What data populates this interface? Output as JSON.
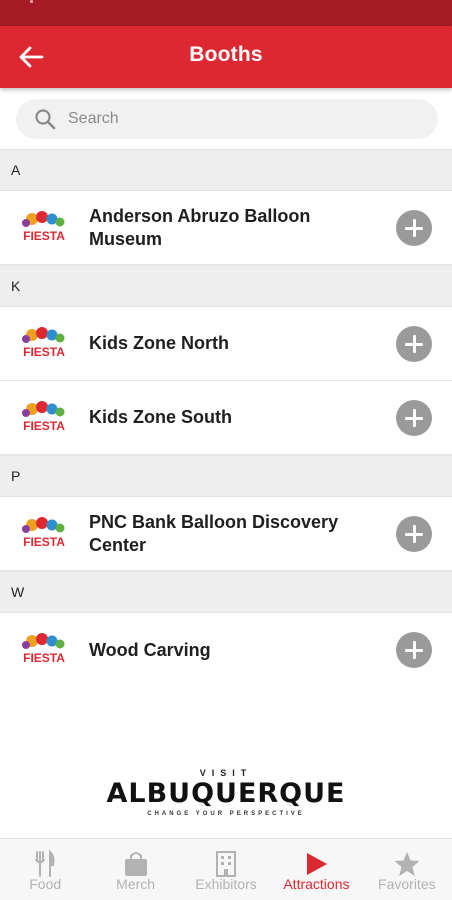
{
  "header": {
    "title": "Booths"
  },
  "search": {
    "placeholder": "Search",
    "value": ""
  },
  "sections": [
    {
      "letter": "A",
      "items": [
        {
          "name": "Anderson Abruzo Balloon Museum"
        }
      ]
    },
    {
      "letter": "K",
      "items": [
        {
          "name": "Kids Zone North"
        },
        {
          "name": "Kids Zone South"
        }
      ]
    },
    {
      "letter": "P",
      "items": [
        {
          "name": "PNC Bank Balloon Discovery Center"
        }
      ]
    },
    {
      "letter": "W",
      "items": [
        {
          "name": "Wood Carving"
        }
      ]
    }
  ],
  "logo_text": "FIESTA",
  "sponsor": {
    "visit": "VISIT",
    "brand": "ALBUQUERQUE",
    "tagline": "CHANGE YOUR PERSPECTIVE"
  },
  "tabs": [
    {
      "label": "Food",
      "icon": "fork-knife-icon"
    },
    {
      "label": "Merch",
      "icon": "shopping-bag-icon"
    },
    {
      "label": "Exhibitors",
      "icon": "building-icon"
    },
    {
      "label": "Attractions",
      "icon": "play-icon",
      "active": true
    },
    {
      "label": "Favorites",
      "icon": "star-icon"
    }
  ],
  "colors": {
    "primary": "#dd2832",
    "status_bar": "#a51c26",
    "add_button": "#9a9a9a",
    "inactive_tab": "#b2b2b2"
  }
}
